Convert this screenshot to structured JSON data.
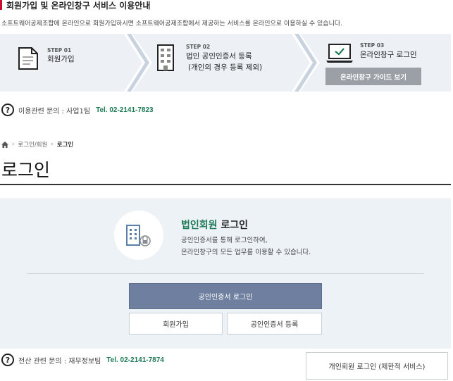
{
  "section": {
    "title": "회원가입 및 온라인창구 서비스 이용안내",
    "description": "소프트웨어공제조합에 온라인으로 회원가입하시면 소프트웨어공제조합에서 제공하는 서비스를 온라인으로 이용하실 수 있습니다."
  },
  "steps": [
    {
      "label": "STEP 01",
      "name": "회원가입",
      "icon": "document-icon"
    },
    {
      "label": "STEP 02",
      "name": "법인 공인인증서 등록",
      "sub": "(개인의 경우 등록 제외)",
      "icon": "building-icon"
    },
    {
      "label": "STEP 03",
      "name": "온라인창구 로그인",
      "icon": "laptop-check-icon"
    }
  ],
  "guide_button": "온라인창구 가이드 보기",
  "inquiry_top": {
    "label": "이용관련 문의 : 사업1팀",
    "tel": "Tel. 02-2141-7823"
  },
  "breadcrumb": {
    "home_icon": "home-icon",
    "level1": "로그인/회원",
    "current": "로그인"
  },
  "page_title": "로그인",
  "login": {
    "title_accent": "법인회원",
    "title_rest": " 로그인",
    "desc1": "공인인증서를 통해 로그인하여,",
    "desc2": "온라인창구의 모든 업무를 이용할 수 있습니다.",
    "cert_login_button": "공인인증서 로그인",
    "join_button": "회원가입",
    "cert_register_button": "공인인증서 등록"
  },
  "inquiry_bottom": {
    "label": "전산 관련 문의 : 재무정보팀",
    "tel": "Tel. 02-2141-7874"
  },
  "personal_login_button": "개인회원 로그인 (제한적 서비스)",
  "colors": {
    "accent_red": "#c8102e",
    "green": "#1f7a57",
    "primary_button": "#6f7f9f",
    "panel_bg": "#edf2f7"
  }
}
